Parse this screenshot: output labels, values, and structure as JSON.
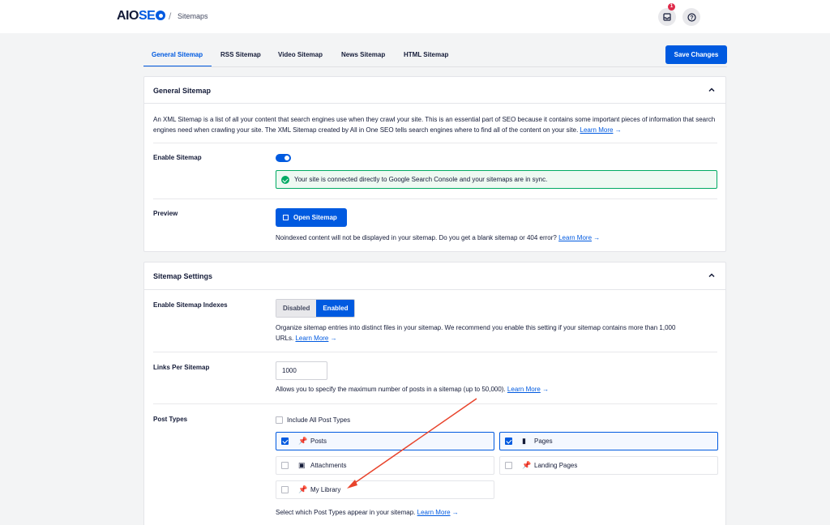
{
  "header": {
    "logo_main": "AIO",
    "logo_accent": "SE",
    "crumb_sep": "/",
    "breadcrumb": "Sitemaps",
    "notification_count": "1"
  },
  "tabs": [
    {
      "label": "General Sitemap",
      "active": true
    },
    {
      "label": "RSS Sitemap"
    },
    {
      "label": "Video Sitemap"
    },
    {
      "label": "News Sitemap"
    },
    {
      "label": "HTML Sitemap"
    }
  ],
  "save_label": "Save Changes",
  "general": {
    "title": "General Sitemap",
    "description": "An XML Sitemap is a list of all your content that search engines use when they crawl your site. This is an essential part of SEO because it contains some important pieces of information that search engines need when crawling your site. The XML Sitemap created by All in One SEO tells search engines where to find all of the content on your site.",
    "learn_more": "Learn More",
    "arrow": "→",
    "enable_label": "Enable Sitemap",
    "enabled": true,
    "alert_text": "Your site is connected directly to Google Search Console and your sitemaps are in sync.",
    "preview_label": "Preview",
    "open_button": "Open Sitemap",
    "preview_note": "Noindexed content will not be displayed in your sitemap. Do you get a blank sitemap or 404 error?"
  },
  "settings": {
    "title": "Sitemap Settings",
    "indexes_label": "Enable Sitemap Indexes",
    "seg_off": "Disabled",
    "seg_on": "Enabled",
    "indexes_note": "Organize sitemap entries into distinct files in your sitemap. We recommend you enable this setting if your sitemap contains more than 1,000",
    "indexes_note2": "URLs.",
    "links_label": "Links Per Sitemap",
    "links_value": "1000",
    "links_note": "Allows you to specify the maximum number of posts in a sitemap (up to 50,000).",
    "post_types_label": "Post Types",
    "include_all": "Include All Post Types",
    "post_types": [
      {
        "label": "Posts",
        "checked": true
      },
      {
        "label": "Pages",
        "checked": true
      },
      {
        "label": "Attachments",
        "checked": false
      },
      {
        "label": "Landing Pages",
        "checked": false
      },
      {
        "label": "My Library",
        "checked": false
      }
    ],
    "post_types_note": "Select which Post Types appear in your sitemap."
  },
  "colors": {
    "accent": "#005ae0",
    "success": "#00aa63",
    "annotation_arrow": "#e8442c"
  }
}
